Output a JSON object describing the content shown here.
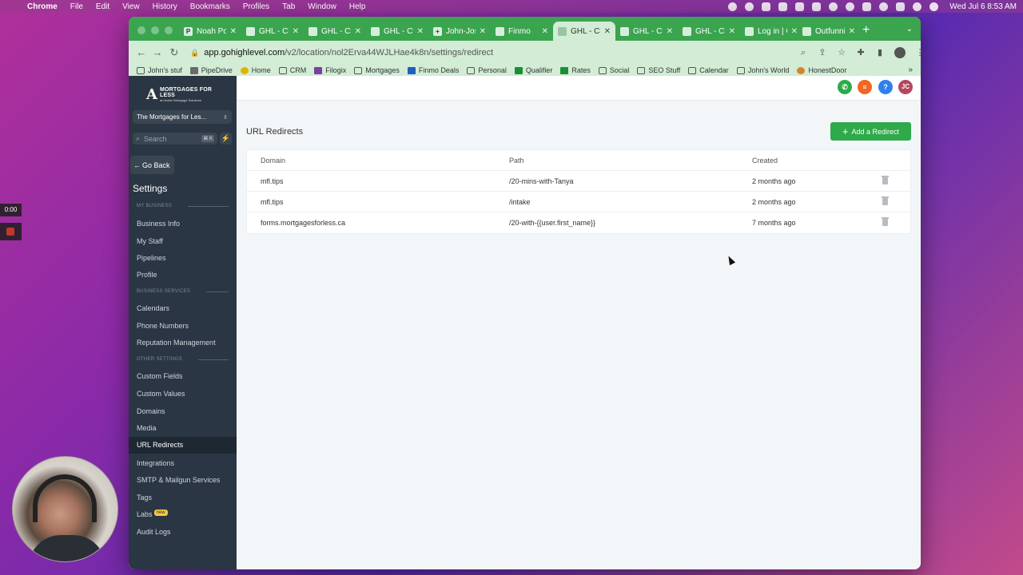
{
  "menubar": {
    "app": "Chrome",
    "items": [
      "File",
      "Edit",
      "View",
      "History",
      "Bookmarks",
      "Profiles",
      "Tab",
      "Window",
      "Help"
    ],
    "clock": "Wed Jul 6  8:53 AM"
  },
  "browser": {
    "tabs": [
      {
        "label": "Noah Po",
        "icon": "P"
      },
      {
        "label": "GHL - Cl",
        "icon": ""
      },
      {
        "label": "GHL - Cl",
        "icon": ""
      },
      {
        "label": "GHL - Cl",
        "icon": ""
      },
      {
        "label": "John-Jos",
        "icon": "+"
      },
      {
        "label": "Finmo",
        "icon": ""
      },
      {
        "label": "GHL - Cl",
        "icon": "",
        "active": true
      },
      {
        "label": "GHL - Cl",
        "icon": ""
      },
      {
        "label": "GHL - Cl",
        "icon": ""
      },
      {
        "label": "Log in | C",
        "icon": ""
      },
      {
        "label": "Outfunni",
        "icon": ""
      }
    ],
    "url_host": "app.gohighlevel.com",
    "url_path": "/v2/location/nol2Erva44WJLHae4k8n/settings/redirect",
    "bookmarks": [
      {
        "label": "John's stuf",
        "icon": "folder"
      },
      {
        "label": "PipeDrive",
        "icon": "pipedrive"
      },
      {
        "label": "Home",
        "icon": "home"
      },
      {
        "label": "CRM",
        "icon": "folder"
      },
      {
        "label": "Filogix",
        "icon": "filogix"
      },
      {
        "label": "Mortgages",
        "icon": "folder"
      },
      {
        "label": "Finmo Deals",
        "icon": "finmo"
      },
      {
        "label": "Personal",
        "icon": "folder"
      },
      {
        "label": "Qualifier",
        "icon": "sheet"
      },
      {
        "label": "Rates",
        "icon": "sheet"
      },
      {
        "label": "Social",
        "icon": "folder"
      },
      {
        "label": "SEO Stuff",
        "icon": "folder"
      },
      {
        "label": "Calendar",
        "icon": "folder"
      },
      {
        "label": "John's World",
        "icon": "folder"
      },
      {
        "label": "HonestDoor",
        "icon": "honestdoor"
      }
    ],
    "bookmarks_more": "»"
  },
  "sidebar": {
    "logo_name": "MORTGAGES FOR LESS",
    "logo_sub": "an Axiom Mortgage Solutions",
    "account": "The Mortgages for Les...",
    "search_placeholder": "Search",
    "search_kbd": "⌘ K",
    "go_back": "Go Back",
    "settings_title": "Settings",
    "sections": {
      "my_business": "MY BUSINESS",
      "business_services": "BUSINESS SERVICES",
      "other_settings": "OTHER SETTINGS"
    },
    "items": {
      "business_info": "Business Info",
      "my_staff": "My Staff",
      "pipelines": "Pipelines",
      "profile": "Profile",
      "calendars": "Calendars",
      "phone_numbers": "Phone Numbers",
      "reputation": "Reputation Management",
      "custom_fields": "Custom Fields",
      "custom_values": "Custom Values",
      "domains": "Domains",
      "media": "Media",
      "url_redirects": "URL Redirects",
      "integrations": "Integrations",
      "smtp": "SMTP & Mailgun Services",
      "tags": "Tags",
      "labs": "Labs",
      "labs_badge": "new",
      "audit_logs": "Audit Logs"
    }
  },
  "topbar": {
    "avatar_initials": "JC",
    "help": "?"
  },
  "main": {
    "title": "URL Redirects",
    "add_button": "Add a Redirect",
    "columns": {
      "domain": "Domain",
      "path": "Path",
      "created": "Created"
    },
    "rows": [
      {
        "domain": "mfl.tips",
        "path": "/20-mins-with-Tanya",
        "created": "2 months ago"
      },
      {
        "domain": "mfl.tips",
        "path": "/intake",
        "created": "2 months ago"
      },
      {
        "domain": "forms.mortgagesforless.ca",
        "path": "/20-with-{{user.first_name}}",
        "created": "7 months ago"
      }
    ]
  },
  "recorder": {
    "time": "0:00"
  },
  "colors": {
    "tab_strip": "#3ba44f",
    "sidebar": "#2a3643",
    "primary_button": "#2eaa4b",
    "phone_button": "#2eaa4b",
    "list_button": "#f26522",
    "help_button": "#2f80ed",
    "avatar": "#b5485d"
  }
}
